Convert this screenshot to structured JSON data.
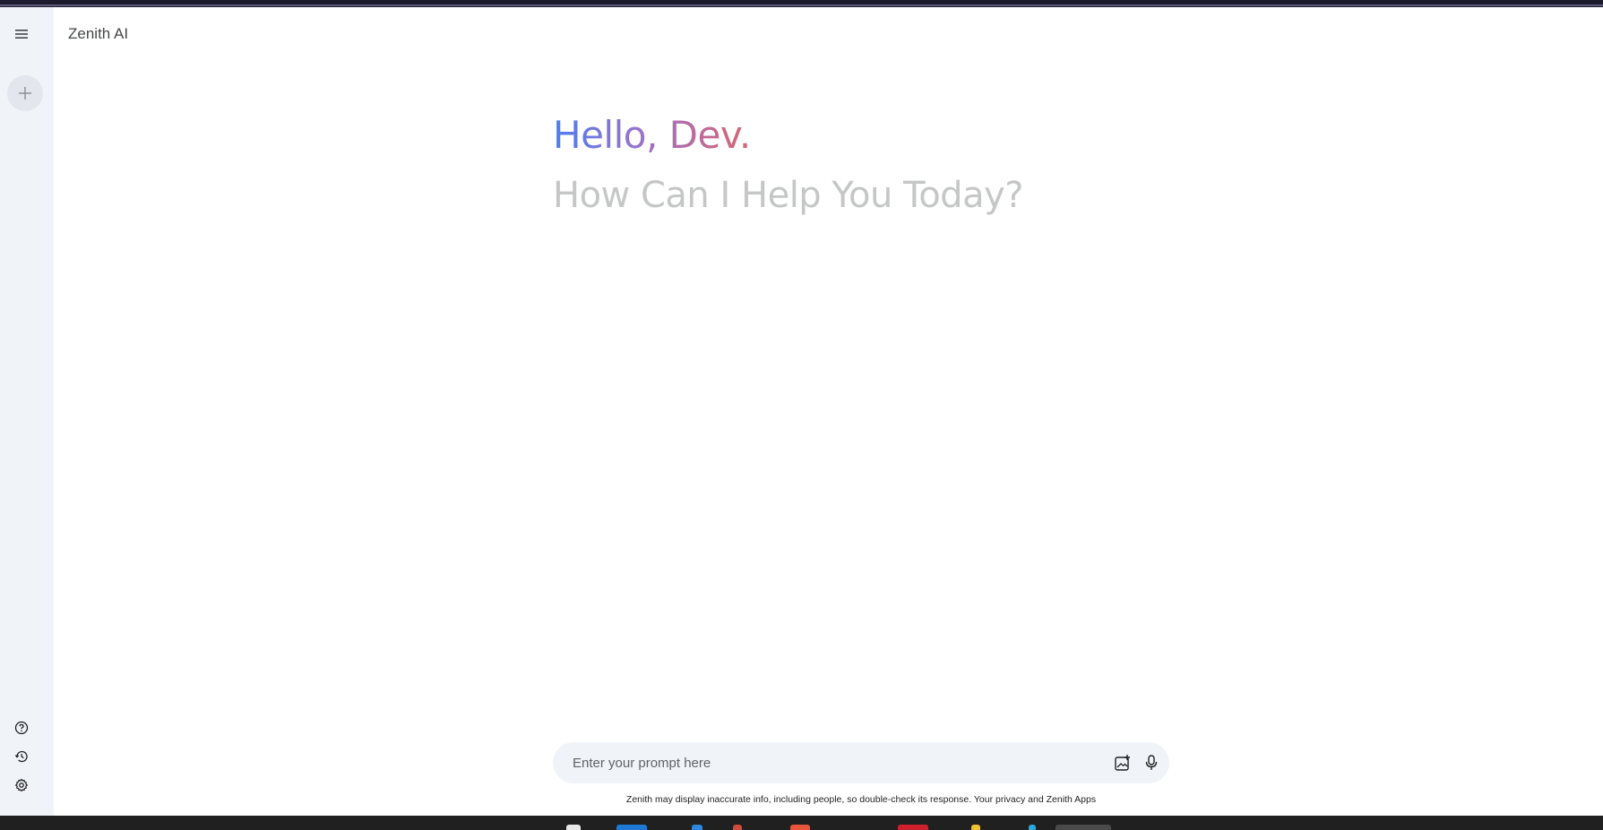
{
  "app": {
    "title": "Zenith AI"
  },
  "sidebar": {
    "menu_icon": "menu-icon",
    "new_chat_icon": "plus-icon",
    "bottom": [
      {
        "icon": "help-icon"
      },
      {
        "icon": "history-icon"
      },
      {
        "icon": "settings-icon"
      }
    ]
  },
  "greeting": {
    "hello": "Hello, Dev.",
    "subtitle": "How Can I Help You Today?"
  },
  "prompt": {
    "placeholder": "Enter your prompt here",
    "value": "",
    "image_icon": "image-upload-icon",
    "mic_icon": "microphone-icon"
  },
  "disclaimer": "Zenith may display inaccurate info, including people, so double-check its response. Your privacy and Zenith Apps",
  "colors": {
    "sidebar_bg": "#f0f4f9",
    "gradient_start": "#4c7ef0",
    "gradient_mid": "#9b72cb",
    "gradient_end": "#d96570",
    "subtitle": "#c4c7c5"
  }
}
